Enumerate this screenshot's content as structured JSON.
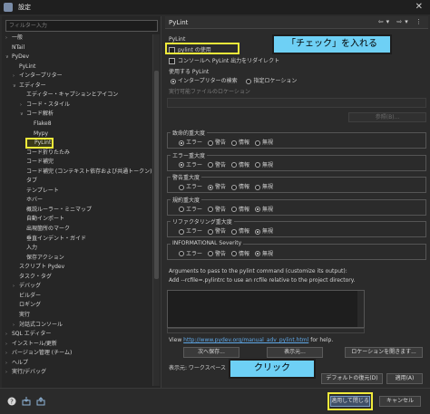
{
  "window": {
    "title": "設定"
  },
  "filter": {
    "placeholder": "フィルター入力"
  },
  "tree": [
    {
      "label": "一般",
      "arrow": "›",
      "indent": 0
    },
    {
      "label": "NTail",
      "arrow": "",
      "indent": 0
    },
    {
      "label": "PyDev",
      "arrow": "∨",
      "indent": 0
    },
    {
      "label": "PyLint",
      "arrow": "",
      "indent": 1
    },
    {
      "label": "インタープリター",
      "arrow": "›",
      "indent": 1
    },
    {
      "label": "エディター",
      "arrow": "∨",
      "indent": 1
    },
    {
      "label": "エディター・キャプションとアイコン",
      "arrow": "",
      "indent": 2
    },
    {
      "label": "コード・スタイル",
      "arrow": "›",
      "indent": 2
    },
    {
      "label": "コード解析",
      "arrow": "∨",
      "indent": 2
    },
    {
      "label": "Flake8",
      "arrow": "",
      "indent": 3
    },
    {
      "label": "Mypy",
      "arrow": "",
      "indent": 3
    },
    {
      "label": "PyLint",
      "arrow": "",
      "indent": 3,
      "selected": true
    },
    {
      "label": "コード折りたたみ",
      "arrow": "",
      "indent": 2
    },
    {
      "label": "コード補完",
      "arrow": "",
      "indent": 2
    },
    {
      "label": "コード補完 (コンテキスト依存および共通トークン)",
      "arrow": "",
      "indent": 2
    },
    {
      "label": "タブ",
      "arrow": "",
      "indent": 2
    },
    {
      "label": "テンプレート",
      "arrow": "",
      "indent": 2
    },
    {
      "label": "ホバー",
      "arrow": "",
      "indent": 2
    },
    {
      "label": "概説ルーラー・ミニマップ",
      "arrow": "",
      "indent": 2
    },
    {
      "label": "自動インポート",
      "arrow": "",
      "indent": 2
    },
    {
      "label": "出現箇所のマーク",
      "arrow": "",
      "indent": 2
    },
    {
      "label": "垂直インデント・ガイド",
      "arrow": "",
      "indent": 2
    },
    {
      "label": "入力",
      "arrow": "",
      "indent": 2
    },
    {
      "label": "保存アクション",
      "arrow": "",
      "indent": 2
    },
    {
      "label": "スクリプト Pydev",
      "arrow": "",
      "indent": 1
    },
    {
      "label": "タスク・タグ",
      "arrow": "",
      "indent": 1
    },
    {
      "label": "デバッグ",
      "arrow": "›",
      "indent": 1
    },
    {
      "label": "ビルダー",
      "arrow": "",
      "indent": 1
    },
    {
      "label": "ロギング",
      "arrow": "",
      "indent": 1
    },
    {
      "label": "実行",
      "arrow": "",
      "indent": 1
    },
    {
      "label": "対話式コンソール",
      "arrow": "›",
      "indent": 1
    },
    {
      "label": "SQL エディター",
      "arrow": "›",
      "indent": 0
    },
    {
      "label": "インストール/更新",
      "arrow": "›",
      "indent": 0
    },
    {
      "label": "バージョン管理 (チーム)",
      "arrow": "›",
      "indent": 0
    },
    {
      "label": "ヘルプ",
      "arrow": "›",
      "indent": 0
    },
    {
      "label": "実行/デバッグ",
      "arrow": "›",
      "indent": 0
    }
  ],
  "page": {
    "title": "PyLint",
    "section_label": "PyLint",
    "use_pylint": "pylint の使用",
    "redirect_console": "コンソールへ PyLint 出力をリダイレクト",
    "use_pylint_label": "使用する PyLint",
    "radio_interpreter": "インタープリターの検索",
    "radio_location": "指定ロケーション",
    "exe_location_label": "実行可能ファイルのロケーション",
    "browse_button": "参照(B)...",
    "severity_groups": [
      {
        "title": "致命的重大度",
        "selected": "エラー"
      },
      {
        "title": "エラー重大度",
        "selected": "エラー"
      },
      {
        "title": "警告重大度",
        "selected": "警告"
      },
      {
        "title": "規約重大度",
        "selected": "無視"
      },
      {
        "title": "リファクタリング重大度",
        "selected": "無視"
      },
      {
        "title": "INFORMATIONAL Severity",
        "selected": "無視"
      }
    ],
    "severity_options": [
      "エラー",
      "警告",
      "情報",
      "無視"
    ],
    "args_line1": "Arguments to pass to the pylint command (customize its output):",
    "args_line2": "Add --rcfile=.pylintrc to use an rcfile relative to the project directory.",
    "view_prefix": "View",
    "view_link": "http://www.pydev.org/manual_adv_pylint.html",
    "view_suffix": "for help.",
    "btn_next_save": "次へ保存...",
    "btn_show": "表示元...",
    "btn_open_location": "ロケーションを開きます...",
    "display_source": "表示元: ワークスペース",
    "btn_restore_defaults": "デフォルトの復元(D)",
    "btn_apply": "適用(A)"
  },
  "footer": {
    "btn_apply_close": "適用して閉じる",
    "btn_cancel": "キャンセル"
  },
  "annotations": {
    "callout_check": "「チェック」を入れる",
    "callout_click": "クリック",
    "callout_color": "#6ed0f5",
    "highlight_color": "#f0ea3a"
  }
}
